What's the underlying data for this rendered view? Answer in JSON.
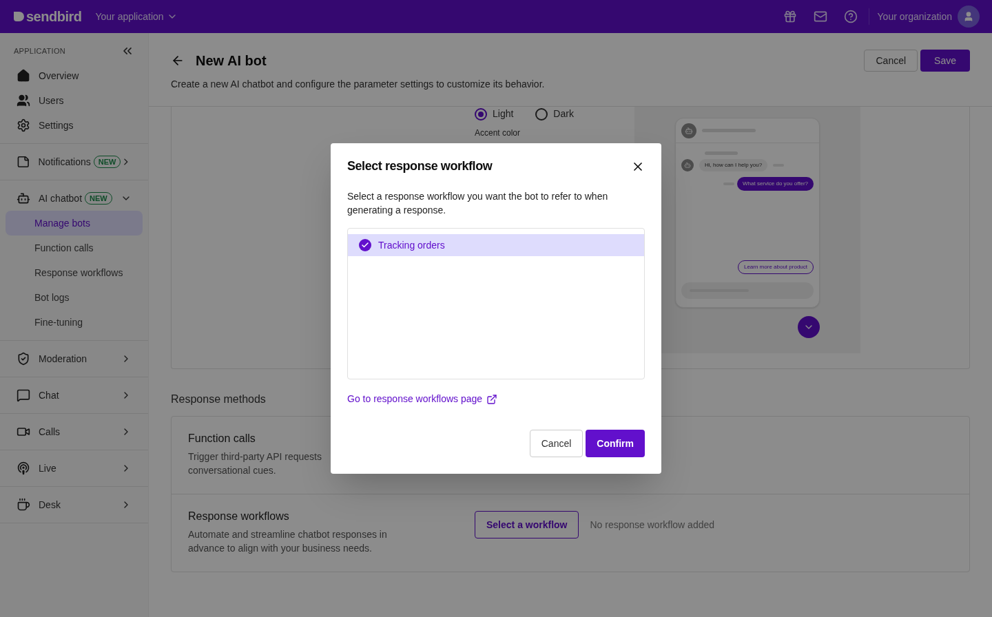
{
  "topbar": {
    "logo": "sendbird",
    "app_selector": "Your application",
    "organization": "Your organization"
  },
  "sidebar": {
    "section_label": "APPLICATION",
    "groups": [
      {
        "items": [
          {
            "label": "Overview"
          },
          {
            "label": "Users"
          },
          {
            "label": "Settings"
          }
        ]
      },
      {
        "items": [
          {
            "label": "Notifications",
            "badge": "NEW",
            "expanded": false
          }
        ]
      },
      {
        "items": [
          {
            "label": "AI chatbot",
            "badge": "NEW",
            "expanded": true,
            "children": [
              {
                "label": "Manage bots",
                "selected": true
              },
              {
                "label": "Function calls",
                "selected": false
              },
              {
                "label": "Response workflows",
                "selected": false
              },
              {
                "label": "Bot logs",
                "selected": false
              },
              {
                "label": "Fine-tuning",
                "selected": false
              }
            ]
          }
        ]
      },
      {
        "items": [
          {
            "label": "Moderation",
            "expanded": false
          }
        ]
      },
      {
        "items": [
          {
            "label": "Chat",
            "expanded": false
          }
        ]
      },
      {
        "items": [
          {
            "label": "Calls",
            "expanded": false
          }
        ]
      },
      {
        "items": [
          {
            "label": "Live",
            "expanded": false
          }
        ]
      },
      {
        "items": [
          {
            "label": "Desk",
            "expanded": false
          }
        ]
      }
    ]
  },
  "page": {
    "title": "New AI bot",
    "subtitle": "Create a new AI chatbot and configure the parameter settings to customize its behavior.",
    "cancel": "Cancel",
    "save": "Save"
  },
  "appearance": {
    "themes": [
      {
        "label": "Light",
        "selected": true
      },
      {
        "label": "Dark",
        "selected": false
      }
    ],
    "accent_label": "Accent color"
  },
  "preview": {
    "bot_message": "Hi, how can I help you?",
    "user_message": "What service do you offer?",
    "suggestion": "Learn more about product"
  },
  "response_methods": {
    "heading": "Response methods",
    "rows": [
      {
        "title": "Function calls",
        "description": "Trigger third-party API requests\nconversational cues.",
        "kind": "plain"
      },
      {
        "title": "Response workflows",
        "description": "Automate and streamline chatbot responses in advance to align with your business needs.",
        "kind": "workflow",
        "button": "Select a workflow",
        "status": "No response workflow added"
      }
    ]
  },
  "dialog": {
    "title": "Select response workflow",
    "description": "Select a response workflow you want the bot to refer to when generating a response.",
    "workflows": [
      {
        "label": "Tracking orders",
        "selected": true
      }
    ],
    "link": "Go to response workflows page",
    "cancel": "Cancel",
    "confirm": "Confirm"
  }
}
